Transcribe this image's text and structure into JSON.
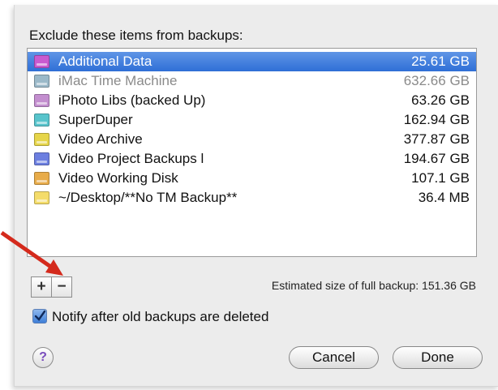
{
  "heading": "Exclude these items from backups:",
  "items": [
    {
      "name": "Additional Data",
      "size": "25.61 GB",
      "color": "#c95ad0",
      "selected": true,
      "dim": false
    },
    {
      "name": "iMac Time Machine",
      "size": "632.66 GB",
      "color": "#9bb9c9",
      "selected": false,
      "dim": true
    },
    {
      "name": "iPhoto Libs (backed Up)",
      "size": "63.26 GB",
      "color": "#c38ecf",
      "selected": false,
      "dim": false
    },
    {
      "name": "SuperDuper",
      "size": "162.94 GB",
      "color": "#58c4cc",
      "selected": false,
      "dim": false
    },
    {
      "name": "Video Archive",
      "size": "377.87 GB",
      "color": "#e6d54a",
      "selected": false,
      "dim": false
    },
    {
      "name": "Video Project Backups  l",
      "size": "194.67 GB",
      "color": "#6c7fe0",
      "selected": false,
      "dim": false
    },
    {
      "name": "Video Working Disk",
      "size": "107.1 GB",
      "color": "#e8ac4a",
      "selected": false,
      "dim": false
    },
    {
      "name": "~/Desktop/**No TM Backup**",
      "size": "36.4 MB",
      "color": "#f4dc6a",
      "selected": false,
      "dim": false
    }
  ],
  "controls": {
    "add_label": "+",
    "remove_label": "−",
    "estimate": "Estimated size of full backup: 151.36 GB",
    "notify_label": "Notify after old backups are deleted",
    "notify_checked": true,
    "help_label": "?",
    "cancel_label": "Cancel",
    "done_label": "Done"
  },
  "colors": {
    "selection": "#3a78da",
    "annotation_arrow": "#d42a1c"
  }
}
